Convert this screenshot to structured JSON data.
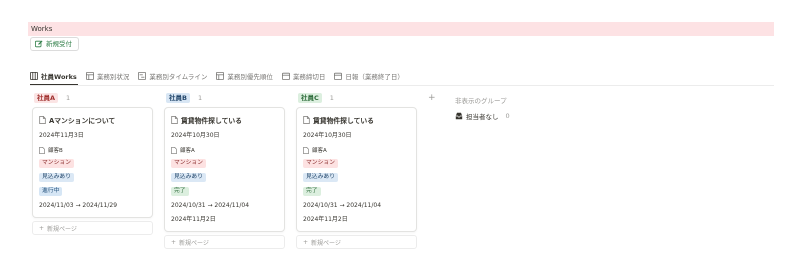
{
  "page": {
    "title": "Works"
  },
  "toolbar": {
    "new_button": "新規受付"
  },
  "tabs": [
    {
      "label": "社員Works",
      "icon": "board-icon",
      "active": true
    },
    {
      "label": "業務別状況",
      "icon": "table-icon",
      "active": false
    },
    {
      "label": "業務別タイムライン",
      "icon": "timeline-icon",
      "active": false
    },
    {
      "label": "業務別優先順位",
      "icon": "table-icon",
      "active": false
    },
    {
      "label": "業務締切日",
      "icon": "calendar-icon",
      "active": false
    },
    {
      "label": "日報（業務終了日）",
      "icon": "calendar-icon",
      "active": false
    }
  ],
  "columns": [
    {
      "tag": "社員A",
      "tag_bg": "#fbe4e4",
      "tag_color": "#a0302e",
      "count": "1",
      "card": {
        "title": "Aマンションについて",
        "date": "2024年11月3日",
        "client": "顧客B",
        "tags": [
          {
            "label": "マンション",
            "bg": "#fde2e2",
            "color": "#8c2f2f"
          },
          {
            "label": "見込みあり",
            "bg": "#dbe8f5",
            "color": "#23476b"
          },
          {
            "label": "進行中",
            "bg": "#d6e6f5",
            "color": "#1f4e79"
          }
        ],
        "range": "2024/11/03 → 2024/11/29",
        "end_date": ""
      },
      "new_page": "新規ページ"
    },
    {
      "tag": "社員B",
      "tag_bg": "#d8e6f4",
      "tag_color": "#23476b",
      "count": "1",
      "card": {
        "title": "賃貸物件探している",
        "date": "2024年10月30日",
        "client": "顧客A",
        "tags": [
          {
            "label": "マンション",
            "bg": "#fde2e2",
            "color": "#8c2f2f"
          },
          {
            "label": "見込みあり",
            "bg": "#dbe8f5",
            "color": "#23476b"
          },
          {
            "label": "完了",
            "bg": "#dcefdf",
            "color": "#2d6b3a"
          }
        ],
        "range": "2024/10/31 → 2024/11/04",
        "end_date": "2024年11月2日"
      },
      "new_page": "新規ページ"
    },
    {
      "tag": "社員C",
      "tag_bg": "#dcefdf",
      "tag_color": "#2d6b3a",
      "count": "1",
      "card": {
        "title": "賃貸物件探している",
        "date": "2024年10月30日",
        "client": "顧客A",
        "tags": [
          {
            "label": "マンション",
            "bg": "#fde2e2",
            "color": "#8c2f2f"
          },
          {
            "label": "見込みあり",
            "bg": "#dbe8f5",
            "color": "#23476b"
          },
          {
            "label": "完了",
            "bg": "#dcefdf",
            "color": "#2d6b3a"
          }
        ],
        "range": "2024/10/31 → 2024/11/04",
        "end_date": "2024年11月2日"
      },
      "new_page": "新規ページ"
    }
  ],
  "board": {
    "add_group": "+",
    "hidden_groups_label": "非表示のグループ",
    "no_assignee_label": "担当者なし",
    "no_assignee_count": "0"
  }
}
